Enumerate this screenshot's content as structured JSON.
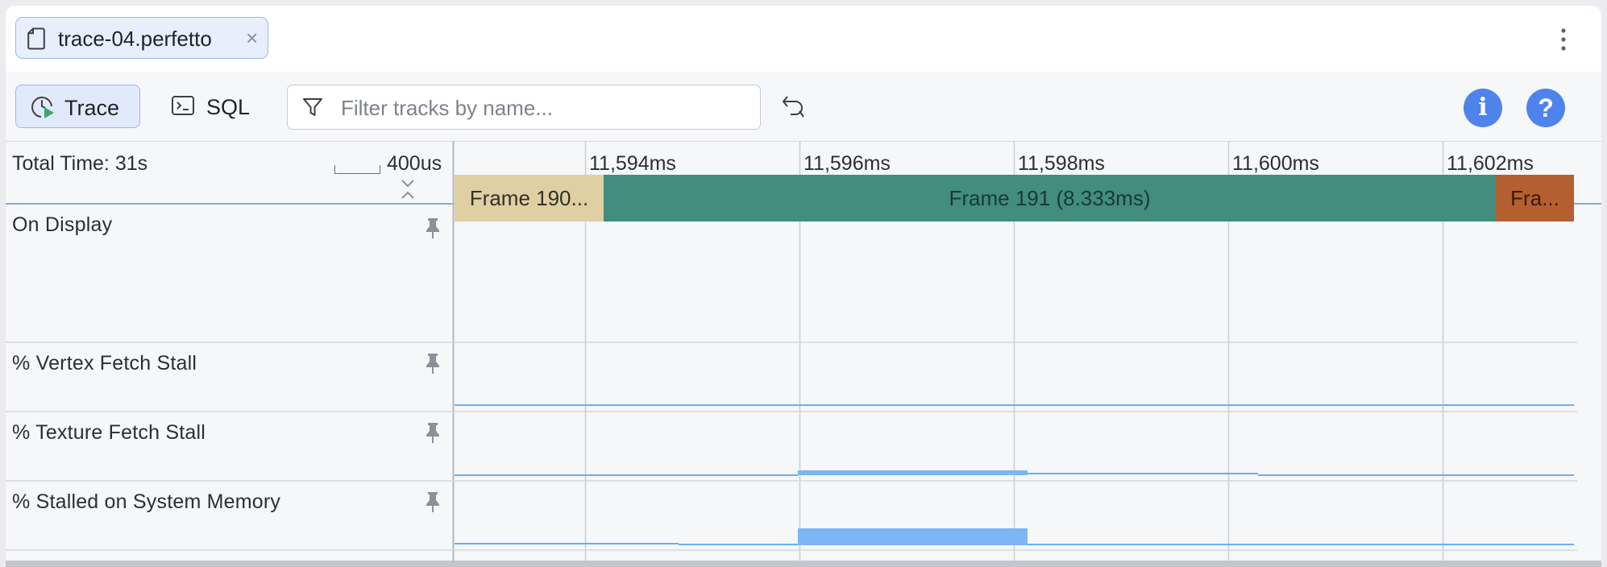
{
  "tab": {
    "file_name": "trace-04.perfetto",
    "close_glyph": "×"
  },
  "toolbar": {
    "trace_label": "Trace",
    "sql_label": "SQL",
    "filter_placeholder": "Filter tracks by name...",
    "filter_value": "",
    "info_glyph": "i",
    "help_glyph": "?"
  },
  "timeline": {
    "total_time": "Total Time: 31s",
    "scale": "400us",
    "ticks": [
      "11,594ms",
      "11,596ms",
      "11,598ms",
      "11,600ms",
      "11,602ms"
    ]
  },
  "tracks": [
    {
      "name": "On Display",
      "slices": [
        {
          "label": "Frame 190...",
          "color": "#dfcfa3"
        },
        {
          "label": "Frame 191 (8.333ms)",
          "color": "#428d7d"
        },
        {
          "label": "Fra...",
          "color": "#b45f30"
        }
      ]
    },
    {
      "name": "% Vertex Fetch Stall"
    },
    {
      "name": "% Texture Fetch Stall"
    },
    {
      "name": "% Stalled on System Memory"
    }
  ],
  "icons": {
    "file": "file-icon",
    "close": "close-icon",
    "menu": "kebab-menu-icon",
    "trace": "trace-timer-icon",
    "sql": "terminal-icon",
    "filter": "filter-icon",
    "undo": "undo-icon",
    "info": "info-icon",
    "help": "help-icon",
    "pin": "pin-icon",
    "collapse": "collapse-icon"
  },
  "colors": {
    "accent": "#4f83ec",
    "counter_line": "#6aaef0",
    "counter_fill": "#7cb6f4",
    "tab_active_bg": "#e7effc"
  }
}
